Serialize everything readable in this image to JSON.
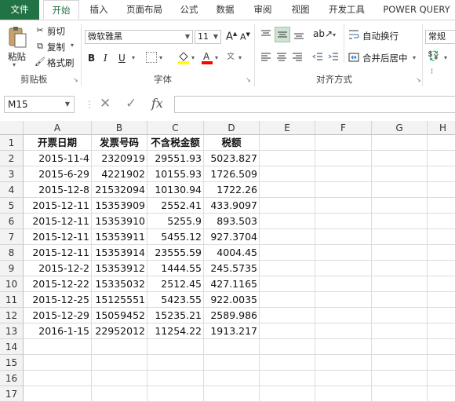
{
  "tabs": [
    "文件",
    "开始",
    "插入",
    "页面布局",
    "公式",
    "数据",
    "审阅",
    "视图",
    "开发工具",
    "POWER QUERY"
  ],
  "clipboard": {
    "paste": "粘贴",
    "cut": "剪切",
    "copy": "复制",
    "format_painter": "格式刷",
    "group": "剪贴板"
  },
  "font": {
    "name": "微软雅黑",
    "size": "11",
    "bold": "B",
    "italic": "I",
    "underline": "U",
    "group": "字体",
    "increase": "A",
    "decrease": "A"
  },
  "alignment": {
    "wrap_text": "自动换行",
    "merge_center": "合并后居中",
    "group": "对齐方式"
  },
  "number": {
    "format": "常规"
  },
  "formula_bar": {
    "name_box": "M15",
    "fx": "fx",
    "value": ""
  },
  "columns": [
    "A",
    "B",
    "C",
    "D",
    "E",
    "F",
    "G",
    "H"
  ],
  "rows": [
    "1",
    "2",
    "3",
    "4",
    "5",
    "6",
    "7",
    "8",
    "9",
    "10",
    "11",
    "12",
    "13",
    "14",
    "15",
    "16",
    "17"
  ],
  "cells": [
    [
      "开票日期",
      "发票号码",
      "不含税金额",
      "税额"
    ],
    [
      "2015-11-4",
      "2320919",
      "29551.93",
      "5023.827"
    ],
    [
      "2015-6-29",
      "4221902",
      "10155.93",
      "1726.509"
    ],
    [
      "2015-12-8",
      "21532094",
      "10130.94",
      "1722.26"
    ],
    [
      "2015-12-11",
      "15353909",
      "2552.41",
      "433.9097"
    ],
    [
      "2015-12-11",
      "15353910",
      "5255.9",
      "893.503"
    ],
    [
      "2015-12-11",
      "15353911",
      "5455.12",
      "927.3704"
    ],
    [
      "2015-12-11",
      "15353914",
      "23555.59",
      "4004.45"
    ],
    [
      "2015-12-2",
      "15353912",
      "1444.55",
      "245.5735"
    ],
    [
      "2015-12-22",
      "15335032",
      "2512.45",
      "427.1165"
    ],
    [
      "2015-12-25",
      "15125551",
      "5423.55",
      "922.0035"
    ],
    [
      "2015-12-29",
      "15059452",
      "15235.21",
      "2589.986"
    ],
    [
      "2016-1-15",
      "22952012",
      "11254.22",
      "1913.217"
    ]
  ],
  "colors": {
    "excel_green": "#217346",
    "font_color": "#ff0000",
    "fill_color": "#ffff00"
  }
}
